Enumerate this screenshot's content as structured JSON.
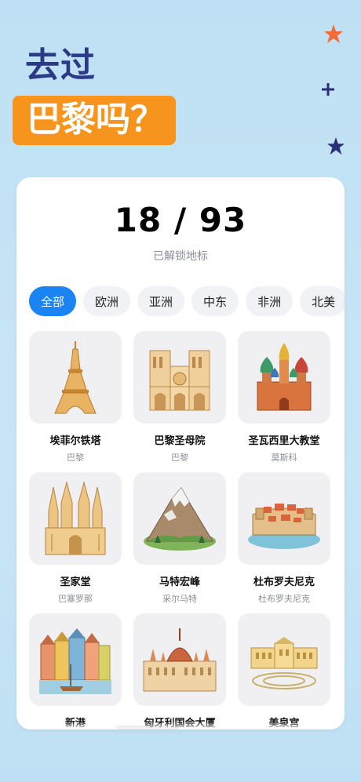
{
  "headline": {
    "line1": "去过",
    "line2": "巴黎吗？"
  },
  "colors": {
    "accent": "#1a84f3",
    "banner": "#f7941d",
    "title": "#2b3a86"
  },
  "decorations": [
    "star-icon-orange",
    "plus-icon-navy",
    "star-icon-navy"
  ],
  "progress": {
    "count": "18 / 93",
    "label": "已解锁地标"
  },
  "tabs": [
    {
      "label": "全部",
      "active": true
    },
    {
      "label": "欧洲"
    },
    {
      "label": "亚洲"
    },
    {
      "label": "中东"
    },
    {
      "label": "非洲"
    },
    {
      "label": "北美"
    }
  ],
  "landmarks": [
    {
      "name": "埃菲尔铁塔",
      "city": "巴黎",
      "icon": "eiffel-tower-icon"
    },
    {
      "name": "巴黎圣母院",
      "city": "巴黎",
      "icon": "notre-dame-icon"
    },
    {
      "name": "圣瓦西里大教堂",
      "city": "莫斯科",
      "icon": "st-basils-cathedral-icon"
    },
    {
      "name": "圣家堂",
      "city": "巴塞罗那",
      "icon": "sagrada-familia-icon"
    },
    {
      "name": "马特宏峰",
      "city": "采尔马特",
      "icon": "matterhorn-icon"
    },
    {
      "name": "杜布罗夫尼克",
      "city": "杜布罗夫尼克",
      "icon": "dubrovnik-icon"
    },
    {
      "name": "新港",
      "city": "",
      "icon": "nyhavn-icon"
    },
    {
      "name": "匈牙利国会大厦",
      "city": "",
      "icon": "hungarian-parliament-icon"
    },
    {
      "name": "美泉宫",
      "city": "",
      "icon": "schonbrunn-palace-icon"
    }
  ]
}
